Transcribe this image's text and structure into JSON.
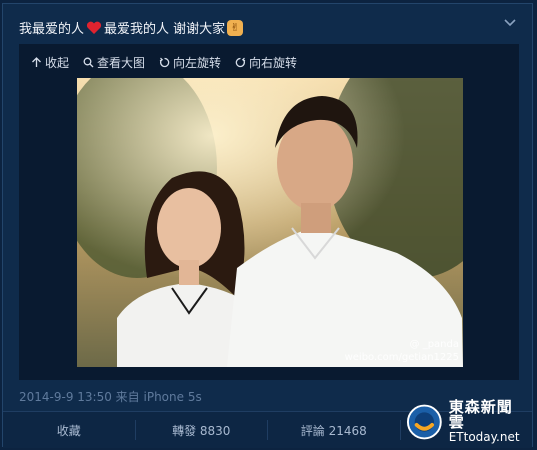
{
  "post": {
    "text_before_heart": "我最爱的人",
    "text_after_heart": "最爱我的人 谢谢大家",
    "meta": "2014-9-9 13:50 来自 iPhone 5s"
  },
  "toolbar": {
    "collapse": "收起",
    "view_large": "查看大图",
    "rotate_left": "向左旋转",
    "rotate_right": "向右旋转"
  },
  "photo": {
    "watermark_handle": "@ _panda",
    "watermark_url": "weibo.com/getian1225"
  },
  "actions": {
    "favorite": "收藏",
    "repost": "轉發 8830",
    "comment": "評論 21468"
  },
  "logo": {
    "cn": "東森新聞雲",
    "en": "ETtoday.net"
  },
  "colors": {
    "background": "#0c2340",
    "card": "#0f2b4b",
    "panel": "#091a30",
    "heart": "#e0232f",
    "meta_text": "#5f7a9c"
  },
  "icons": [
    "heart-icon",
    "rock-hand-icon",
    "chevron-down-icon",
    "collapse-icon",
    "search-icon",
    "rotate-left-icon",
    "rotate-right-icon",
    "ettoday-logo"
  ]
}
